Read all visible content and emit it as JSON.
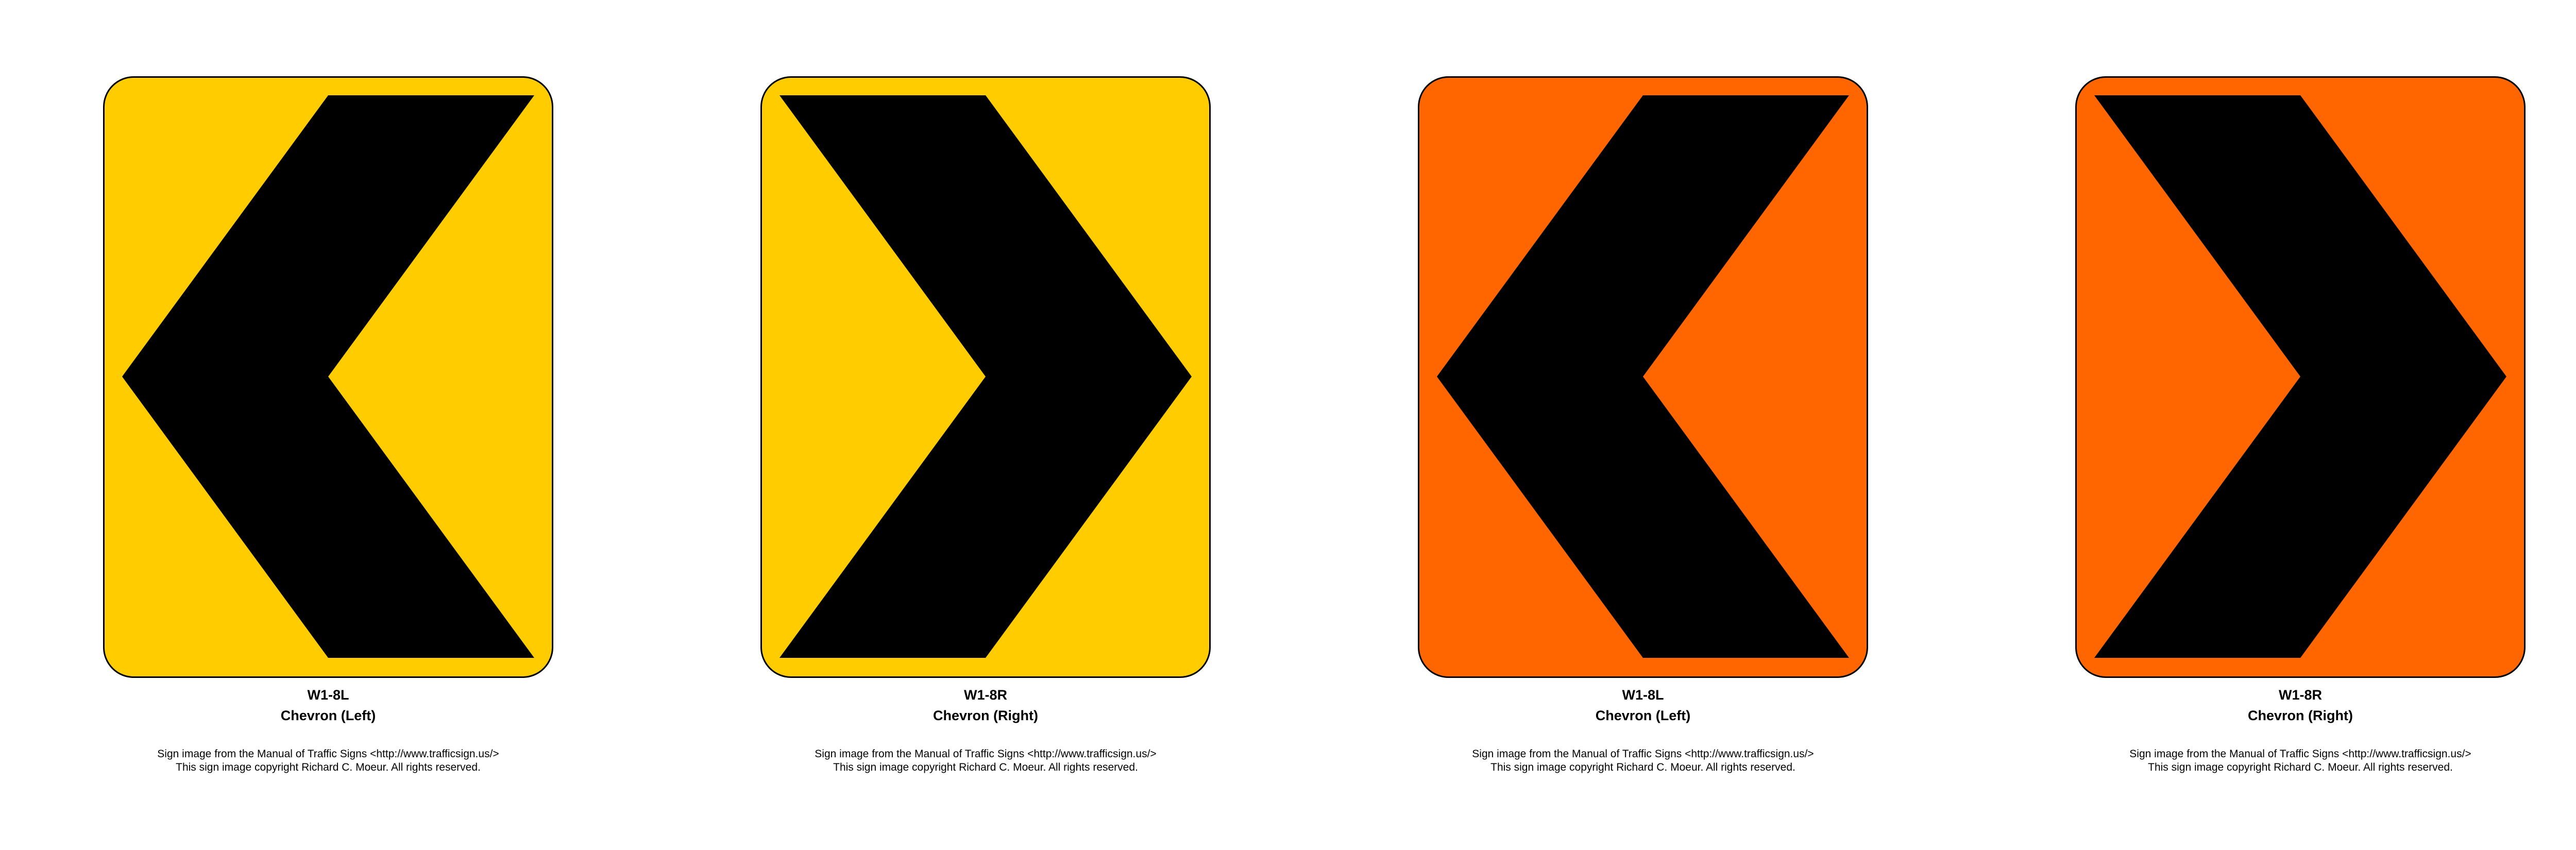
{
  "signs": [
    {
      "code": "W1-8L",
      "name": "Chevron (Left)",
      "direction": "left",
      "background_color": "#FFCC00",
      "symbol_color": "#000000",
      "credit_line1": "Sign image from the Manual of Traffic Signs <http://www.trafficsign.us/>",
      "credit_line2": "This sign image copyright Richard C. Moeur. All rights reserved."
    },
    {
      "code": "W1-8R",
      "name": "Chevron (Right)",
      "direction": "right",
      "background_color": "#FFCC00",
      "symbol_color": "#000000",
      "credit_line1": "Sign image from the Manual of Traffic Signs <http://www.trafficsign.us/>",
      "credit_line2": "This sign image copyright Richard C. Moeur. All rights reserved."
    },
    {
      "code": "W1-8L",
      "name": "Chevron (Left)",
      "direction": "left",
      "background_color": "#FF6600",
      "symbol_color": "#000000",
      "credit_line1": "Sign image from the Manual of Traffic Signs <http://www.trafficsign.us/>",
      "credit_line2": "This sign image copyright Richard C. Moeur. All rights reserved."
    },
    {
      "code": "W1-8R",
      "name": "Chevron (Right)",
      "direction": "right",
      "background_color": "#FF6600",
      "symbol_color": "#000000",
      "credit_line1": "Sign image from the Manual of Traffic Signs <http://www.trafficsign.us/>",
      "credit_line2": "This sign image copyright Richard C. Moeur. All rights reserved."
    }
  ]
}
